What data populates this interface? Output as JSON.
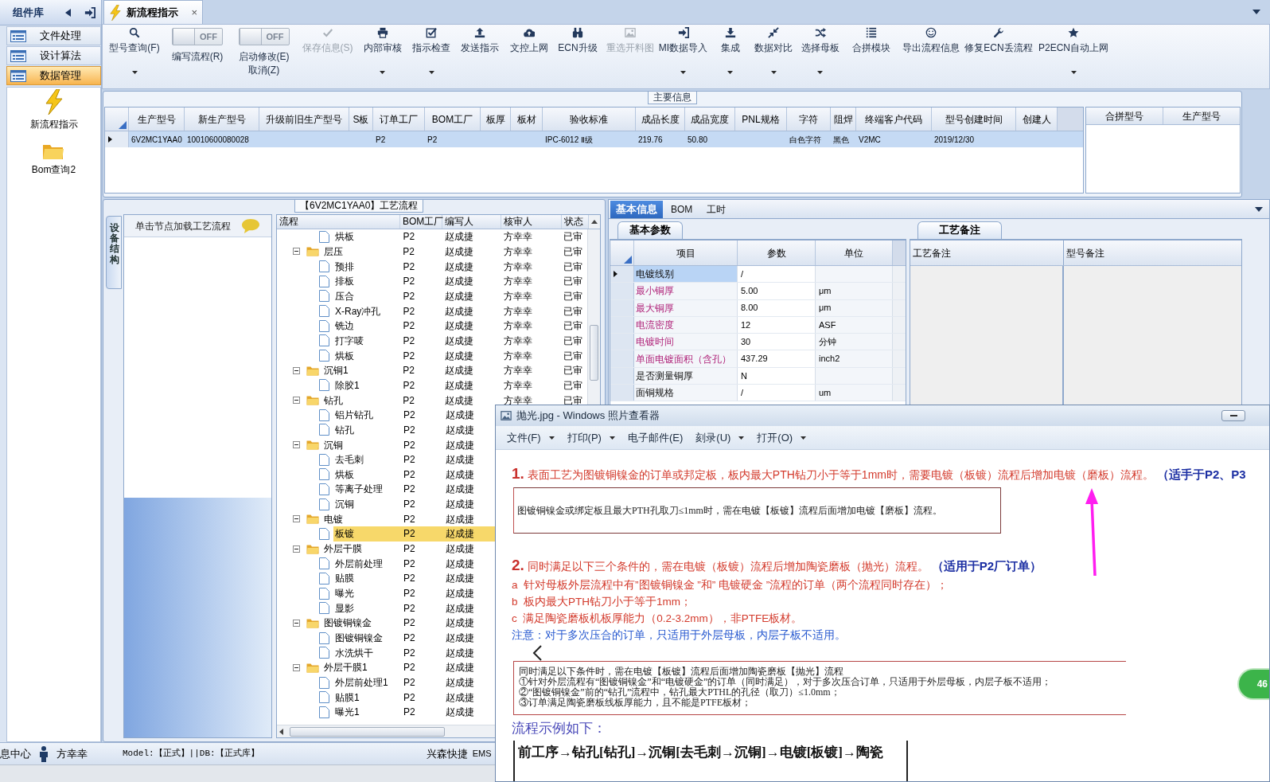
{
  "sidebar": {
    "title": "组件库",
    "items": [
      {
        "label": "文件处理",
        "selected": false
      },
      {
        "label": "设计算法",
        "selected": false
      },
      {
        "label": "数据管理",
        "selected": true
      }
    ],
    "shortcuts": [
      {
        "label": "新流程指示",
        "kind": "lightning"
      },
      {
        "label": "Bom查询2",
        "kind": "folder"
      }
    ]
  },
  "tabs": [
    {
      "label": "新流程指示",
      "selected": true,
      "close": "×"
    }
  ],
  "ribbon": [
    {
      "kind": "button",
      "label": "型号查询(F)",
      "dropdown": true,
      "disabled": false
    },
    {
      "kind": "toggle",
      "label": "编写流程(R)",
      "switch_text": "OFF",
      "on": false
    },
    {
      "kind": "toggle",
      "label": "启动修改(E)\n取消(Z)",
      "switch_text": "OFF",
      "on": false
    },
    {
      "kind": "button",
      "label": "保存信息(S)",
      "dropdown": false,
      "disabled": true
    },
    {
      "kind": "button",
      "label": "内部审核",
      "dropdown": true,
      "disabled": false
    },
    {
      "kind": "button",
      "label": "指示检查",
      "dropdown": true,
      "disabled": false
    },
    {
      "kind": "button",
      "label": "发送指示",
      "dropdown": false,
      "disabled": false
    },
    {
      "kind": "button",
      "label": "文控上网",
      "dropdown": false,
      "disabled": false
    },
    {
      "kind": "button",
      "label": "ECN升级",
      "dropdown": false,
      "disabled": false
    },
    {
      "kind": "button",
      "label": "重选开料图",
      "dropdown": false,
      "disabled": true
    },
    {
      "kind": "button",
      "label": "MI数据导入",
      "dropdown": true,
      "disabled": false
    },
    {
      "kind": "button",
      "label": "集成",
      "dropdown": true,
      "disabled": false
    },
    {
      "kind": "button",
      "label": "数据对比",
      "dropdown": true,
      "disabled": false
    },
    {
      "kind": "button",
      "label": "选择母板",
      "dropdown": true,
      "disabled": false
    },
    {
      "kind": "button",
      "label": "合拼模块",
      "dropdown": false,
      "disabled": false
    },
    {
      "kind": "button",
      "label": "导出流程信息",
      "dropdown": false,
      "disabled": false
    },
    {
      "kind": "button",
      "label": "修复ECN丢流程",
      "dropdown": false,
      "disabled": false
    },
    {
      "kind": "button",
      "label": "P2ECN自动上网",
      "dropdown": true,
      "disabled": false
    }
  ],
  "main_info": {
    "title": "主要信息",
    "columns": [
      "生产型号",
      "新生产型号",
      "升级前旧生产型号",
      "S板",
      "订单工厂",
      "BOM工厂",
      "板厚",
      "板材",
      "验收标准",
      "成品长度",
      "成品宽度",
      "PNL规格",
      "字符",
      "阻焊",
      "终端客户代码",
      "型号创建时间",
      "创建人"
    ],
    "rows": [
      {
        "selected": true,
        "cells": [
          "6V2MC1YAA0",
          "10010600080028",
          null,
          null,
          "P2",
          "P2",
          null,
          null,
          "IPC-6012 Ⅱ级",
          "219.76",
          "50.80",
          null,
          "白色字符",
          "黑色",
          "V2MC",
          "2019/12/30",
          null
        ]
      }
    ],
    "side_columns": [
      "合拼型号",
      "生产型号"
    ]
  },
  "process": {
    "title": "【6V2MC1YAA0】工艺流程",
    "side_tab": "设备结构",
    "hint": "单击节点加载工艺流程",
    "tree": {
      "name_column": "流程",
      "columns": [
        "BOM工厂",
        "编写人",
        "核审人",
        "状态"
      ],
      "rows": [
        {
          "kind": "file",
          "name": "烘板",
          "selected": false,
          "cells": [
            "P2",
            "赵成捷",
            "方幸幸",
            "已审"
          ]
        },
        {
          "kind": "folder",
          "name": "层压",
          "selected": false,
          "expanded": true,
          "cells": [
            "P2",
            "赵成捷",
            "方幸幸",
            "已审"
          ],
          "children": [
            {
              "kind": "file",
              "name": "预排",
              "selected": false,
              "cells": [
                "P2",
                "赵成捷",
                "方幸幸",
                "已审"
              ]
            },
            {
              "kind": "file",
              "name": "排板",
              "selected": false,
              "cells": [
                "P2",
                "赵成捷",
                "方幸幸",
                "已审"
              ]
            },
            {
              "kind": "file",
              "name": "压合",
              "selected": false,
              "cells": [
                "P2",
                "赵成捷",
                "方幸幸",
                "已审"
              ]
            },
            {
              "kind": "file",
              "name": "X-Ray冲孔",
              "selected": false,
              "cells": [
                "P2",
                "赵成捷",
                "方幸幸",
                "已审"
              ]
            },
            {
              "kind": "file",
              "name": "铣边",
              "selected": false,
              "cells": [
                "P2",
                "赵成捷",
                "方幸幸",
                "已审"
              ]
            },
            {
              "kind": "file",
              "name": "打字唛",
              "selected": false,
              "cells": [
                "P2",
                "赵成捷",
                "方幸幸",
                "已审"
              ]
            },
            {
              "kind": "file",
              "name": "烘板",
              "selected": false,
              "cells": [
                "P2",
                "赵成捷",
                "方幸幸",
                "已审"
              ]
            }
          ]
        },
        {
          "kind": "folder",
          "name": "沉铜1",
          "selected": false,
          "expanded": true,
          "cells": [
            "P2",
            "赵成捷",
            "方幸幸",
            "已审"
          ],
          "children": [
            {
              "kind": "file",
              "name": "除胶1",
              "selected": false,
              "cells": [
                "P2",
                "赵成捷",
                "方幸幸",
                "已审"
              ]
            }
          ]
        },
        {
          "kind": "folder",
          "name": "钻孔",
          "selected": false,
          "expanded": true,
          "cells": [
            "P2",
            "赵成捷",
            "方幸幸",
            "已审"
          ],
          "children": [
            {
              "kind": "file",
              "name": "铝片钻孔",
              "selected": false,
              "cells": [
                "P2",
                "赵成捷"
              ]
            },
            {
              "kind": "file",
              "name": "钻孔",
              "selected": false,
              "cells": [
                "P2",
                "赵成捷"
              ]
            }
          ]
        },
        {
          "kind": "folder",
          "name": "沉铜",
          "selected": false,
          "expanded": true,
          "cells": [
            "P2",
            "赵成捷"
          ],
          "children": [
            {
              "kind": "file",
              "name": "去毛刺",
              "selected": false,
              "cells": [
                "P2",
                "赵成捷"
              ]
            },
            {
              "kind": "file",
              "name": "烘板",
              "selected": false,
              "cells": [
                "P2",
                "赵成捷"
              ]
            },
            {
              "kind": "file",
              "name": "等离子处理",
              "selected": false,
              "cells": [
                "P2",
                "赵成捷"
              ]
            },
            {
              "kind": "file",
              "name": "沉铜",
              "selected": false,
              "cells": [
                "P2",
                "赵成捷"
              ]
            }
          ]
        },
        {
          "kind": "folder",
          "name": "电镀",
          "selected": false,
          "expanded": true,
          "cells": [
            "P2",
            "赵成捷"
          ],
          "children": [
            {
              "kind": "file",
              "name": "板镀",
              "selected": true,
              "cells": [
                "P2",
                "赵成捷"
              ]
            }
          ]
        },
        {
          "kind": "folder",
          "name": "外层干膜",
          "selected": false,
          "expanded": true,
          "cells": [
            "P2",
            "赵成捷"
          ],
          "children": [
            {
              "kind": "file",
              "name": "外层前处理",
              "selected": false,
              "cells": [
                "P2",
                "赵成捷"
              ]
            },
            {
              "kind": "file",
              "name": "贴膜",
              "selected": false,
              "cells": [
                "P2",
                "赵成捷"
              ]
            },
            {
              "kind": "file",
              "name": "曝光",
              "selected": false,
              "cells": [
                "P2",
                "赵成捷"
              ]
            },
            {
              "kind": "file",
              "name": "显影",
              "selected": false,
              "cells": [
                "P2",
                "赵成捷"
              ]
            }
          ]
        },
        {
          "kind": "folder",
          "name": "图镀铜镍金",
          "selected": false,
          "expanded": true,
          "cells": [
            "P2",
            "赵成捷"
          ],
          "children": [
            {
              "kind": "file",
              "name": "图镀铜镍金",
              "selected": false,
              "cells": [
                "P2",
                "赵成捷"
              ]
            },
            {
              "kind": "file",
              "name": "水洗烘干",
              "selected": false,
              "cells": [
                "P2",
                "赵成捷"
              ]
            }
          ]
        },
        {
          "kind": "folder",
          "name": "外层干膜1",
          "selected": false,
          "expanded": true,
          "cells": [
            "P2",
            "赵成捷"
          ],
          "children": [
            {
              "kind": "file",
              "name": "外层前处理1",
              "selected": false,
              "cells": [
                "P2",
                "赵成捷"
              ]
            },
            {
              "kind": "file",
              "name": "贴膜1",
              "selected": false,
              "cells": [
                "P2",
                "赵成捷"
              ]
            },
            {
              "kind": "file",
              "name": "曝光1",
              "selected": false,
              "cells": [
                "P2",
                "赵成捷"
              ]
            }
          ]
        }
      ]
    }
  },
  "detail": {
    "tabs": [
      {
        "label": "基本信息",
        "selected": true
      },
      {
        "label": "BOM",
        "selected": false
      },
      {
        "label": "工时",
        "selected": false
      }
    ],
    "params": {
      "tab": "基本参数",
      "columns": [
        "项目",
        "参数",
        "单位"
      ],
      "rows": [
        {
          "item": "电镀线别",
          "value": "/",
          "selected": true,
          "highlighted": false
        },
        {
          "item": "最小铜厚",
          "value": "5.00",
          "unit": "μm",
          "selected": false,
          "highlighted": true
        },
        {
          "item": "最大铜厚",
          "value": "8.00",
          "unit": "μm",
          "selected": false,
          "highlighted": true
        },
        {
          "item": "电流密度",
          "value": "12",
          "unit": "ASF",
          "selected": false,
          "highlighted": true
        },
        {
          "item": "电镀时间",
          "value": "30",
          "unit": "分钟",
          "selected": false,
          "highlighted": true
        },
        {
          "item": "单面电镀面积（含孔）",
          "value": "437.29",
          "unit": "inch2",
          "selected": false,
          "highlighted": true
        },
        {
          "item": "是否测量铜厚",
          "value": "N",
          "selected": false,
          "highlighted": false
        },
        {
          "item": "面铜规格",
          "value": "/",
          "unit": "um",
          "selected": false,
          "highlighted": false
        }
      ]
    },
    "notes": {
      "tab": "工艺备注",
      "columns": [
        "工艺备注",
        "型号备注"
      ]
    }
  },
  "status_bar": {
    "left": "息中心",
    "user": "方幸幸",
    "db": "Model:【正式】||DB:【正式库】",
    "company": "兴森快捷",
    "system": "EMS"
  },
  "viewer": {
    "title": "抛光.jpg - Windows 照片查看器",
    "menu": [
      {
        "label": "文件(F)",
        "dropdown": true
      },
      {
        "label": "打印(P)",
        "dropdown": true
      },
      {
        "label": "电子邮件(E)",
        "dropdown": false
      },
      {
        "label": "刻录(U)",
        "dropdown": true
      },
      {
        "label": "打开(O)",
        "dropdown": true
      }
    ],
    "document": {
      "rule_1": {
        "number": "1.",
        "text": "表面工艺为图镀铜镍金的订单或邦定板，板内最大PTH钻刀小于等于1mm时，需要电镀（板镀）流程后增加电镀（磨板）流程。",
        "note": "（适手于P2、P3"
      },
      "box_1": "图镀铜镍金或绑定板且最大PTH孔取刀≤1mm时，需在电镀【板镀】流程后面增加电镀【磨板】流程。",
      "rule_2": {
        "number": "2.",
        "text": "同时满足以下三个条件的，需在电镀（板镀）流程后增加陶瓷磨板（抛光）流程。",
        "note": "（适用于P2厂订单）"
      },
      "conditions": [
        "a  针对母板外层流程中有”图镀铜镍金 ”和” 电镀硬金 ”流程的订单（两个流程同时存在）；",
        "b  板内最大PTH钻刀小于等于1mm；",
        "c  满足陶瓷磨板机板厚能力（0.2-3.2mm），非PTFE板材。"
      ],
      "caution": "注意：对于多次压合的订单，只适用于外层母板，内层子板不适用。",
      "box_2": [
        "同时满足以下条件时，需在电镀【板镀】流程后面增加陶瓷磨板【抛光】流程",
        "①针对外层流程有“图镀铜镍金”和“电镀硬金”的订单（同时满足），对于多次压合订单，只适用于外层母板，内层子板不适用；",
        "②“图镀铜镍金”前的“钻孔”流程中，钻孔最大PTHL的孔径（取刀）≤1.0mm；",
        "③订单满足陶瓷磨板线板厚能力，且不能是PTFE板材；"
      ],
      "example_title": "流程示例如下：",
      "example": "前工序→钻孔[钻孔]→沉铜[去毛刺→沉铜]→电镀[板镀]→陶瓷"
    },
    "badge": "46"
  }
}
